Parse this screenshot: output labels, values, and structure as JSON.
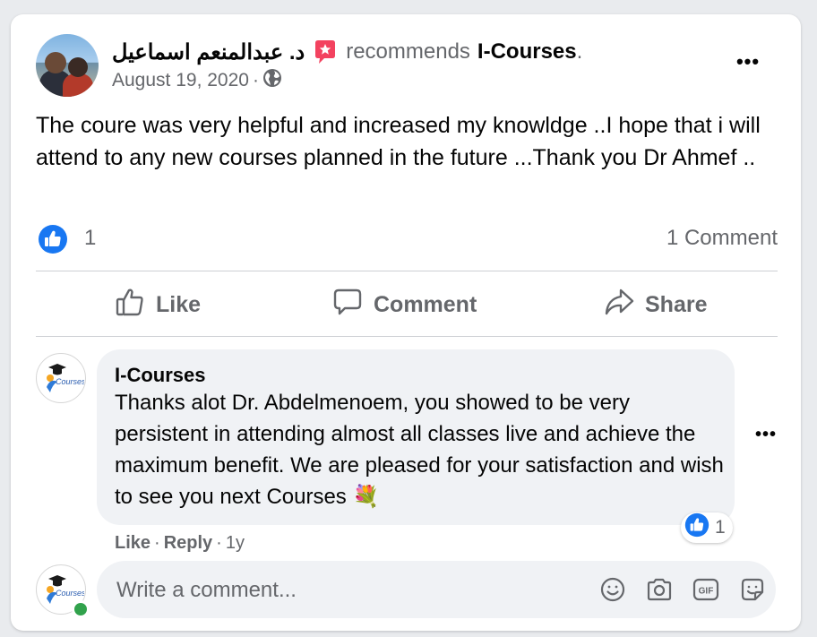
{
  "post": {
    "author": "د. عبدالمنعم اسماعيل",
    "recommends_text": "recommends",
    "page_name": "I-Courses",
    "page_suffix": ".",
    "date": "August 19, 2020",
    "date_separator": "·",
    "privacy_icon": "globe-icon",
    "more_icon": "•••",
    "text": "The coure was very helpful and  increased my knowldge ..I hope that i will attend to any new courses planned  in the future ...Thank you Dr Ahmef .."
  },
  "reactions": {
    "like_count": "1",
    "comments_count": "1 Comment"
  },
  "actions": {
    "like": "Like",
    "comment": "Comment",
    "share": "Share"
  },
  "comment": {
    "author": "I-Courses",
    "text": "Thanks alot Dr. Abdelmenoem, you showed to be very persistent in attending almost all classes live and achieve the maximum benefit. We are pleased for your satisfaction and wish to see you next Courses 💐",
    "reaction_count": "1",
    "like_label": "Like",
    "reply_label": "Reply",
    "separator": "·",
    "age": "1y",
    "more_icon": "•••",
    "avatar_logo_text": "Courses"
  },
  "composer": {
    "placeholder": "Write a comment...",
    "avatar_logo_text": "Courses",
    "icons": [
      "emoji-icon",
      "camera-icon",
      "gif-icon",
      "sticker-icon"
    ],
    "gif_label": "GIF"
  },
  "colors": {
    "accent": "#1877f2",
    "badge": "#f3425f",
    "muted": "#65676b",
    "bubble": "#f0f2f5",
    "online": "#31a24c"
  }
}
